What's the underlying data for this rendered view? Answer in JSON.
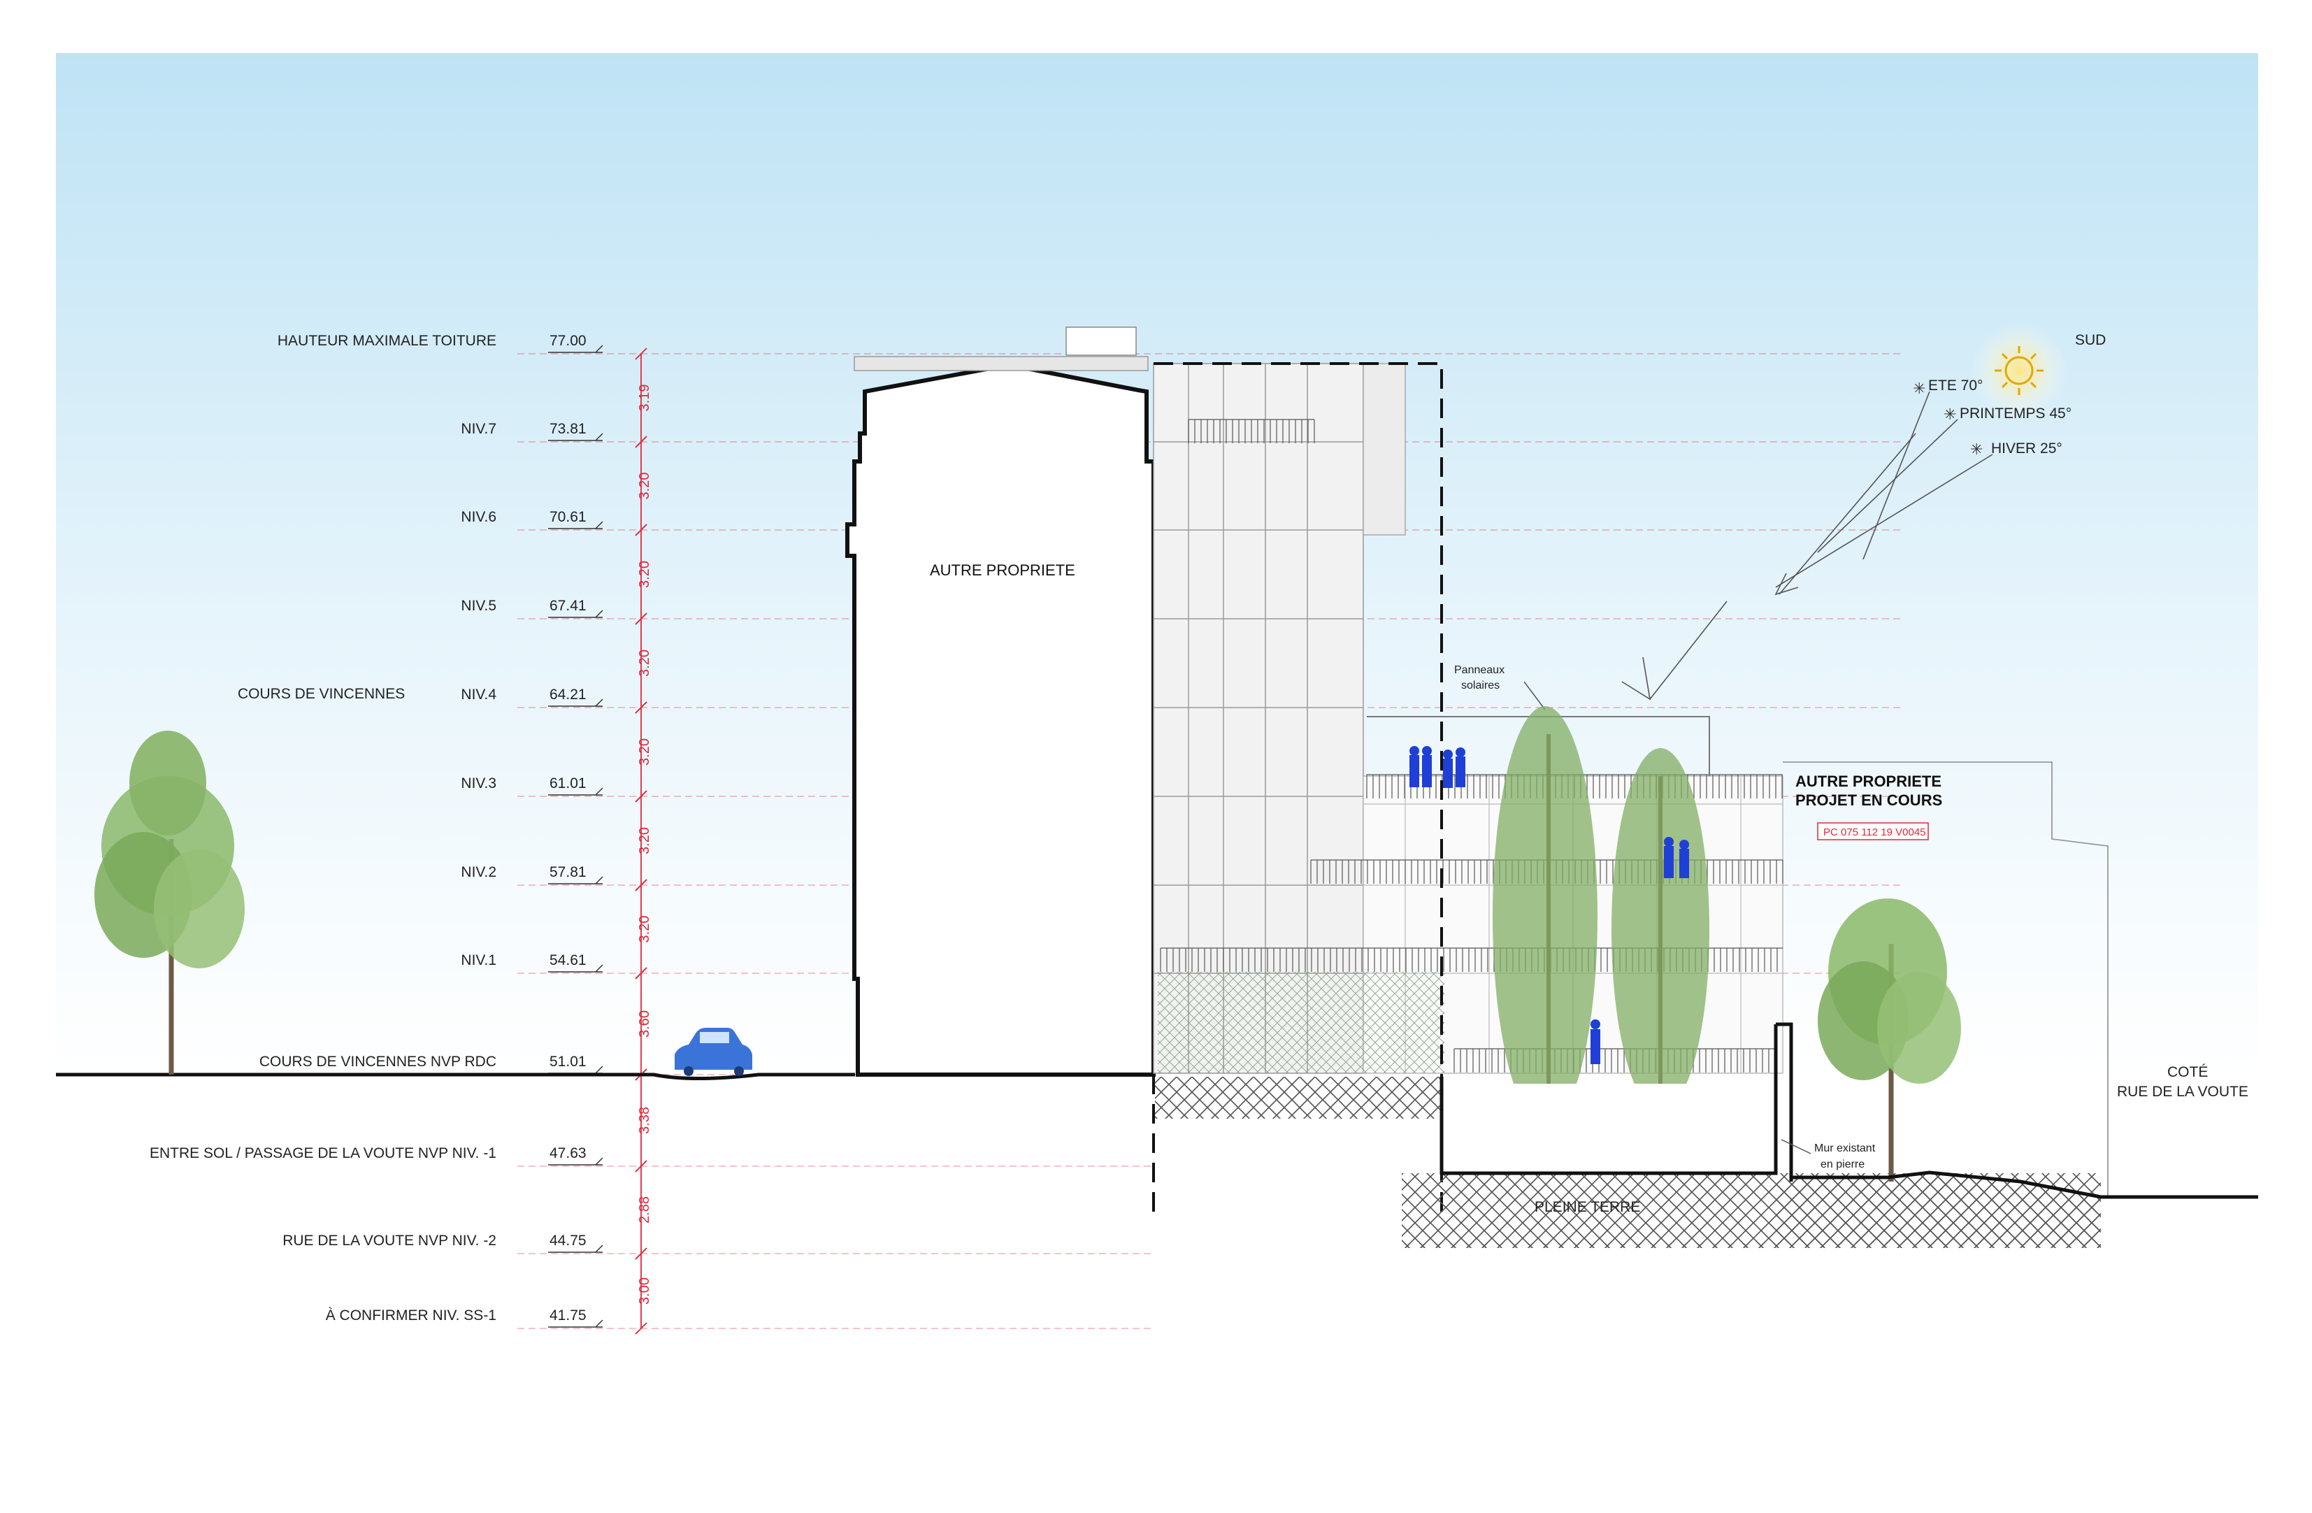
{
  "labels": {
    "site_street": "COURS DE VINCENNES",
    "other_property": "AUTRE PROPRIETE",
    "other_property_project_line1": "AUTRE PROPRIETE",
    "other_property_project_line2": "PROJET EN COURS",
    "permit_number": "PC 075 112 19 V0045",
    "solar_panels_line1": "Panneaux",
    "solar_panels_line2": "solaires",
    "existing_wall_line1": "Mur existant",
    "existing_wall_line2": "en pierre",
    "pleine_terre": "PLEINE TERRE",
    "side_street_line1": "COTÉ",
    "side_street_line2": "RUE DE LA VOUTE"
  },
  "sun": {
    "orientation": "SUD",
    "summer": "ETE  70°",
    "spring": "PRINTEMPS 45°",
    "winter": "HIVER  25°"
  },
  "levels": [
    {
      "name": "HAUTEUR MAXIMALE   TOITURE",
      "value": "77.00"
    },
    {
      "name": "NIV.7",
      "value": "73.81"
    },
    {
      "name": "NIV.6",
      "value": "70.61"
    },
    {
      "name": "NIV.5",
      "value": "67.41"
    },
    {
      "name": "NIV.4",
      "value": "64.21"
    },
    {
      "name": "NIV.3",
      "value": "61.01"
    },
    {
      "name": "NIV.2",
      "value": "57.81"
    },
    {
      "name": "NIV.1",
      "value": "54.61"
    },
    {
      "name": "COURS DE VINCENNES  NVP     RDC",
      "value": "51.01"
    },
    {
      "name": "ENTRE SOL / PASSAGE DE LA VOUTE  NVP   NIV. -1",
      "value": "47.63"
    },
    {
      "name": "RUE DE LA VOUTE  NVP   NIV. -2",
      "value": "44.75"
    },
    {
      "name": "À CONFIRMER   NIV. SS-1",
      "value": "41.75"
    }
  ],
  "floor_heights": [
    "3.19",
    "3.20",
    "3.20",
    "3.20",
    "3.20",
    "3.20",
    "3.20",
    "3.60",
    "3.38",
    "2.88",
    "3.00"
  ],
  "colors": {
    "sky_top": "#bfe3f5",
    "dimension_red": "#e0283a",
    "people_blue": "#1f3fd6",
    "car_blue": "#3a74d8",
    "tree_green": "#7fae5e",
    "sun_yellow": "#f4c400"
  }
}
